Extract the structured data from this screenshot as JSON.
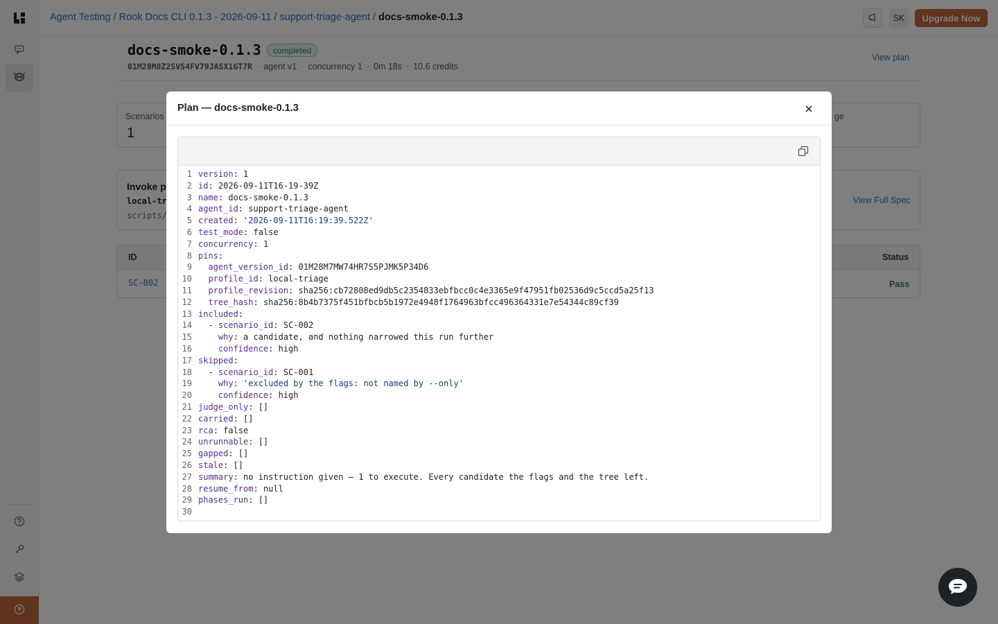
{
  "topbar": {
    "breadcrumbs": [
      "Agent Testing",
      "Rook Docs CLI 0.1.3 - 2026-09-11",
      "support-triage-agent"
    ],
    "current": "docs-smoke-0.1.3",
    "avatar_initials": "SK",
    "upgrade_label": "Upgrade Now"
  },
  "run": {
    "title": "docs-smoke-0.1.3",
    "status": "completed",
    "id": "01M28M8Z2SVS4FV79JASX1GT7R",
    "agent": "agent v1",
    "concurrency": "concurrency 1",
    "duration": "0m 18s",
    "credits": "10.6 credits",
    "view_plan": "View plan"
  },
  "scenarios_card": {
    "label": "Scenarios",
    "value": "1",
    "right_label_fragment": "ge"
  },
  "invoke_card": {
    "title_fragment": "Invoke p",
    "cmd_fragment": "local-tr",
    "path_fragment": "scripts/",
    "view_spec": "View Full Spec"
  },
  "table": {
    "col_id": "ID",
    "col_status": "Status",
    "rows": [
      {
        "id": "SC-002",
        "status": "Pass"
      }
    ]
  },
  "modal": {
    "title": "Plan — docs-smoke-0.1.3",
    "lines": [
      {
        "n": "1",
        "indent": "",
        "dash": "",
        "key": "version",
        "val": "1",
        "vcls": "v"
      },
      {
        "n": "2",
        "indent": "",
        "dash": "",
        "key": "id",
        "val": "2026-09-11T16-19-39Z",
        "vcls": "v"
      },
      {
        "n": "3",
        "indent": "",
        "dash": "",
        "key": "name",
        "val": "docs-smoke-0.1.3",
        "vcls": "v"
      },
      {
        "n": "4",
        "indent": "",
        "dash": "",
        "key": "agent_id",
        "val": "support-triage-agent",
        "vcls": "v"
      },
      {
        "n": "5",
        "indent": "",
        "dash": "",
        "key": "created",
        "val": "'2026-09-11T16:19:39.522Z'",
        "vcls": "s"
      },
      {
        "n": "6",
        "indent": "",
        "dash": "",
        "key": "test_mode",
        "val": "false",
        "vcls": "v"
      },
      {
        "n": "7",
        "indent": "",
        "dash": "",
        "key": "concurrency",
        "val": "1",
        "vcls": "v"
      },
      {
        "n": "8",
        "indent": "",
        "dash": "",
        "key": "pins",
        "val": "",
        "vcls": "v"
      },
      {
        "n": "9",
        "indent": "  ",
        "dash": "",
        "key": "agent_version_id",
        "val": "01M28M7MW74HR7S5PJMK5P34D6",
        "vcls": "v"
      },
      {
        "n": "10",
        "indent": "  ",
        "dash": "",
        "key": "profile_id",
        "val": "local-triage",
        "vcls": "v"
      },
      {
        "n": "11",
        "indent": "  ",
        "dash": "",
        "key": "profile_revision",
        "val": "sha256:cb72808ed9db5c2354833ebfbcc0c4e3365e9f47951fb02536d9c5ccd5a25f13",
        "vcls": "v"
      },
      {
        "n": "12",
        "indent": "  ",
        "dash": "",
        "key": "tree_hash",
        "val": "sha256:8b4b7375f451bfbcb5b1972e4948f1764963bfcc496364331e7e54344c89cf39",
        "vcls": "v"
      },
      {
        "n": "13",
        "indent": "",
        "dash": "",
        "key": "included",
        "val": "",
        "vcls": "v"
      },
      {
        "n": "14",
        "indent": "  ",
        "dash": "- ",
        "key": "scenario_id",
        "val": "SC-002",
        "vcls": "v"
      },
      {
        "n": "15",
        "indent": "    ",
        "dash": "",
        "key": "why",
        "val": "a candidate, and nothing narrowed this run further",
        "vcls": "v"
      },
      {
        "n": "16",
        "indent": "    ",
        "dash": "",
        "key": "confidence",
        "val": "high",
        "vcls": "v"
      },
      {
        "n": "17",
        "indent": "",
        "dash": "",
        "key": "skipped",
        "val": "",
        "vcls": "v"
      },
      {
        "n": "18",
        "indent": "  ",
        "dash": "- ",
        "key": "scenario_id",
        "val": "SC-001",
        "vcls": "v"
      },
      {
        "n": "19",
        "indent": "    ",
        "dash": "",
        "key": "why",
        "val": "'excluded by the flags: not named by --only'",
        "vcls": "s"
      },
      {
        "n": "20",
        "indent": "    ",
        "dash": "",
        "key": "confidence",
        "val": "high",
        "vcls": "v"
      },
      {
        "n": "21",
        "indent": "",
        "dash": "",
        "key": "judge_only",
        "val": "[]",
        "vcls": "v"
      },
      {
        "n": "22",
        "indent": "",
        "dash": "",
        "key": "carried",
        "val": "[]",
        "vcls": "v"
      },
      {
        "n": "23",
        "indent": "",
        "dash": "",
        "key": "rca",
        "val": "false",
        "vcls": "v"
      },
      {
        "n": "24",
        "indent": "",
        "dash": "",
        "key": "unrunnable",
        "val": "[]",
        "vcls": "v"
      },
      {
        "n": "25",
        "indent": "",
        "dash": "",
        "key": "gapped",
        "val": "[]",
        "vcls": "v"
      },
      {
        "n": "26",
        "indent": "",
        "dash": "",
        "key": "stale",
        "val": "[]",
        "vcls": "v"
      },
      {
        "n": "27",
        "indent": "",
        "dash": "",
        "key": "summary",
        "val": "no instruction given — 1 to execute. Every candidate the flags and the tree left.",
        "vcls": "v"
      },
      {
        "n": "28",
        "indent": "",
        "dash": "",
        "key": "resume_from",
        "val": "null",
        "vcls": "v"
      },
      {
        "n": "29",
        "indent": "",
        "dash": "",
        "key": "phases_run",
        "val": "[]",
        "vcls": "v"
      },
      {
        "n": "30",
        "indent": "",
        "dash": "",
        "key": "",
        "val": "",
        "vcls": "v"
      }
    ]
  },
  "icons": {
    "sidebar": [
      "logo-icon",
      "chat-icon",
      "agent-icon",
      "help-icon",
      "key-icon",
      "layers-icon",
      "upload-icon"
    ],
    "topbar": [
      "megaphone-icon"
    ],
    "modal": [
      "close-icon",
      "copy-icon"
    ],
    "fab": [
      "chat-bubble-icon"
    ]
  },
  "colors": {
    "accent": "#c0663a",
    "link": "#2f6fc4",
    "success": "#2d8a45",
    "key": "#5b2e91"
  }
}
